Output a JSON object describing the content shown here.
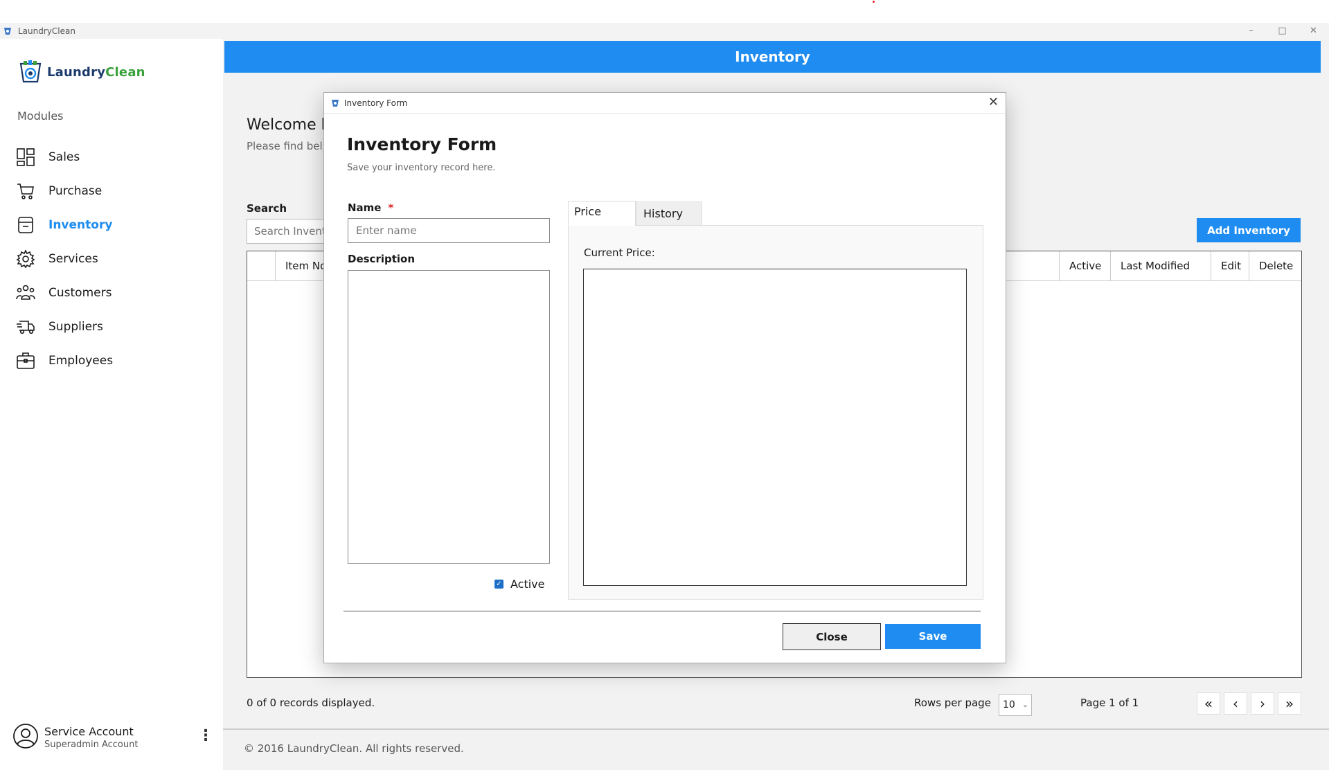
{
  "window": {
    "title": "LaundryClean",
    "controls": [
      "–",
      "□",
      "✕"
    ]
  },
  "brand": {
    "part1": "Laundry",
    "part2": "Clean"
  },
  "sidebar": {
    "modules_label": "Modules",
    "items": [
      {
        "label": "Sales",
        "icon": "dashboard-icon"
      },
      {
        "label": "Purchase",
        "icon": "cart-icon"
      },
      {
        "label": "Inventory",
        "icon": "inventory-icon"
      },
      {
        "label": "Services",
        "icon": "gear-icon"
      },
      {
        "label": "Customers",
        "icon": "people-icon"
      },
      {
        "label": "Suppliers",
        "icon": "truck-icon"
      },
      {
        "label": "Employees",
        "icon": "briefcase-icon"
      }
    ],
    "active_index": 2,
    "account": {
      "name": "Service Account",
      "role": "Superadmin Account"
    }
  },
  "header": {
    "title": "Inventory"
  },
  "main": {
    "welcome": "Welcome b",
    "welcome_sub": "Please find bel",
    "search_label": "Search",
    "search_placeholder": "Search Invent",
    "add_button": "Add Inventory",
    "columns": [
      "Item No",
      "Active",
      "Last Modified",
      "Edit",
      "Delete"
    ],
    "records_info": "0 of 0 records displayed.",
    "rows_per_page_label": "Rows per page",
    "rows_per_page_value": "10",
    "page_info": "Page 1 of 1",
    "pager": [
      "«",
      "‹",
      "›",
      "»"
    ],
    "copyright": "© 2016 LaundryClean. All rights reserved."
  },
  "modal": {
    "window_title": "Inventory Form",
    "close_glyph": "✕",
    "title": "Inventory Form",
    "subtitle": "Save your inventory record here.",
    "name_label": "Name",
    "required_mark": "*",
    "name_placeholder": "Enter name",
    "description_label": "Description",
    "active_label": "Active",
    "active_checked": true,
    "tabs": [
      "Price",
      "History"
    ],
    "current_price_label": "Current Price:",
    "close_button": "Close",
    "save_button": "Save"
  },
  "colors": {
    "accent": "#1e8cf0",
    "brand_dark": "#1a3a6b",
    "brand_green": "#3aa13a"
  }
}
